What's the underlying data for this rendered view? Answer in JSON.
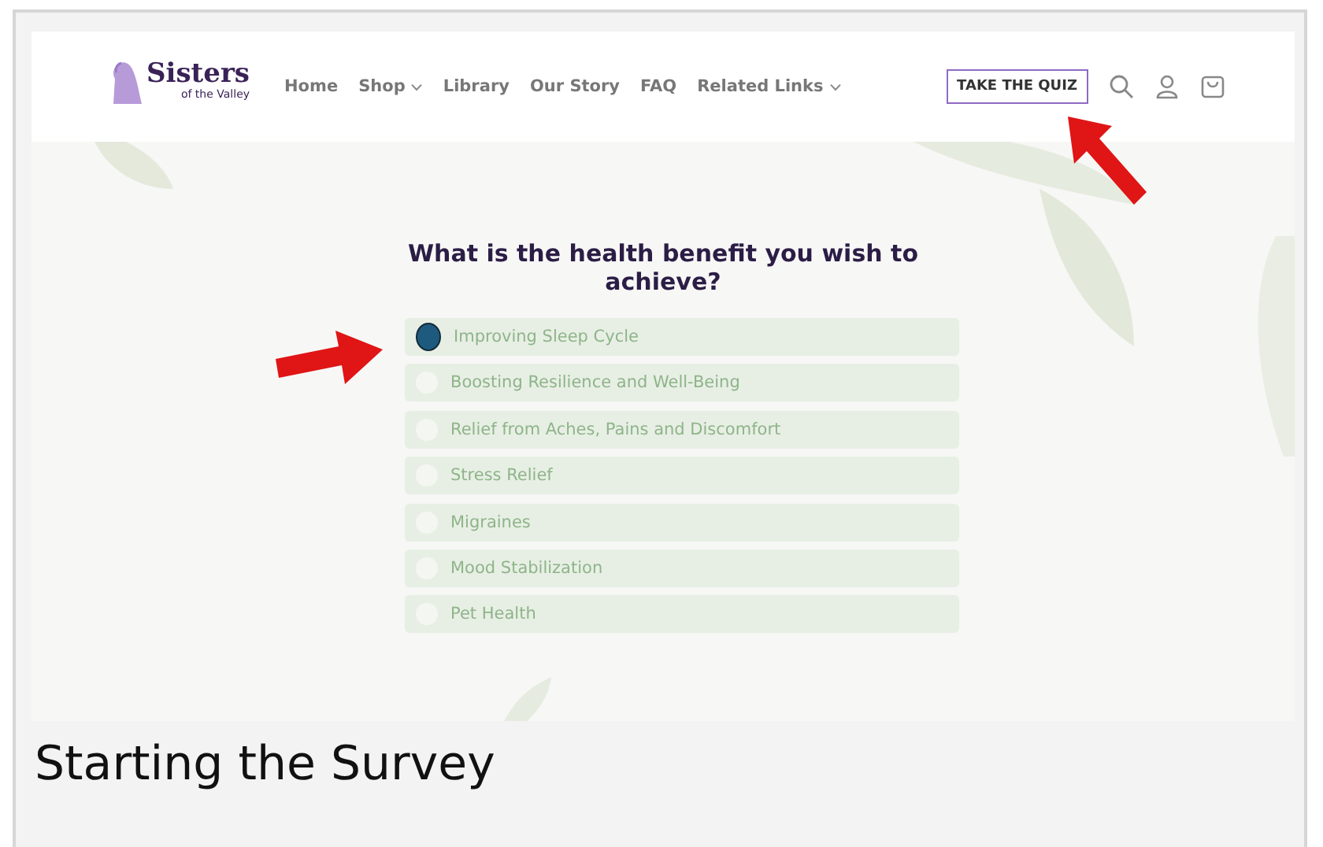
{
  "header": {
    "logo": {
      "name": "Sisters",
      "tagline": "of the Valley"
    },
    "nav": [
      {
        "label": "Home",
        "dropdown": false
      },
      {
        "label": "Shop",
        "dropdown": true
      },
      {
        "label": "Library",
        "dropdown": false
      },
      {
        "label": "Our Story",
        "dropdown": false
      },
      {
        "label": "FAQ",
        "dropdown": false
      },
      {
        "label": "Related Links",
        "dropdown": true
      }
    ],
    "quiz_button": "TAKE THE QUIZ"
  },
  "question": "What is the health benefit you wish to achieve?",
  "options": [
    {
      "label": "Improving Sleep Cycle",
      "selected": true
    },
    {
      "label": "Boosting Resilience and Well-Being",
      "selected": false
    },
    {
      "label": "Relief from Aches, Pains and Discomfort",
      "selected": false
    },
    {
      "label": "Stress Relief",
      "selected": false
    },
    {
      "label": "Migraines",
      "selected": false
    },
    {
      "label": "Mood Stabilization",
      "selected": false
    },
    {
      "label": "Pet Health",
      "selected": false
    }
  ],
  "caption": "Starting the Survey"
}
